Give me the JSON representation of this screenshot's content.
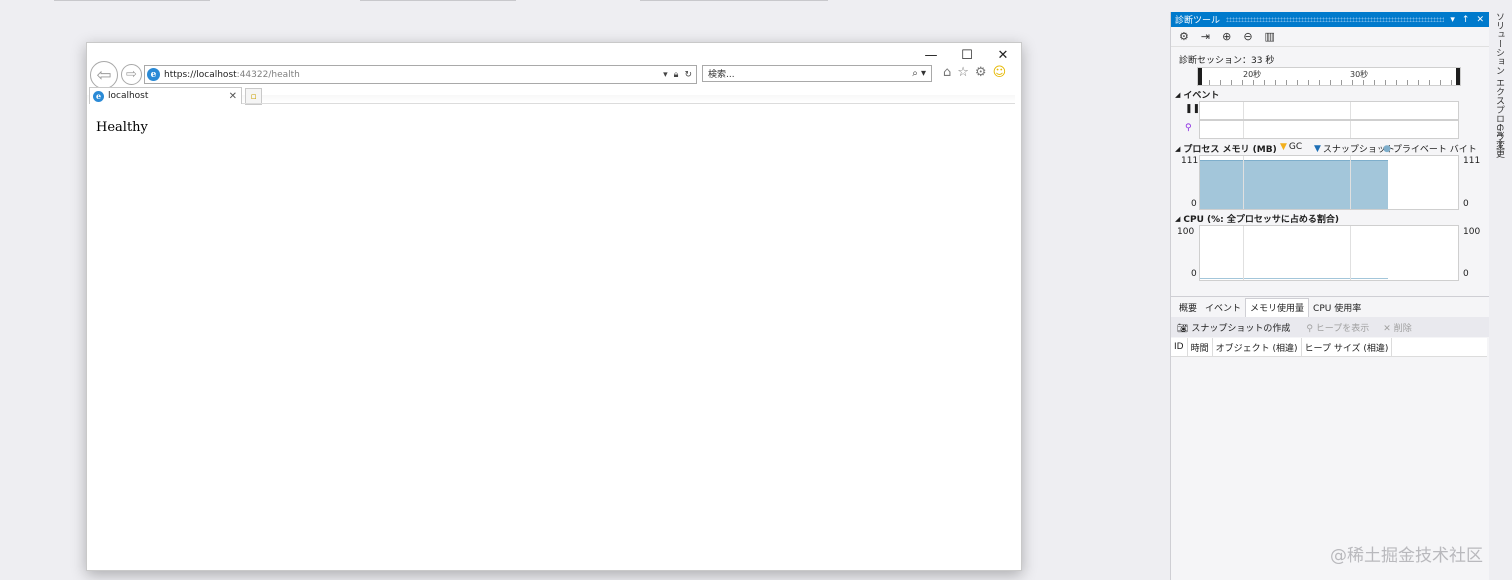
{
  "browser": {
    "window_controls": {
      "minimize": "—",
      "maximize": "☐",
      "close": "✕"
    },
    "back_icon": "⇦",
    "forward_icon": "⇨",
    "address_host": "https://localhost",
    "address_path": ":44322/health",
    "search_placeholder": "検索...",
    "tab_label": "localhost",
    "tab_close": "✕",
    "page_text": "Healthy"
  },
  "diag": {
    "title": "診断ツール",
    "title_buttons": [
      "▾",
      "↑",
      "✕"
    ],
    "session": "診断セッション：33 秒",
    "ruler_labels": [
      "20秒",
      "30秒"
    ],
    "events_section": "イベント",
    "memory_section": "プロセス メモリ (MB)",
    "legend_gc": "GC",
    "legend_snapshot": "スナップショット",
    "legend_private": "プライベート バイト",
    "mem_max": "111",
    "mem_min": "0",
    "cpu_section": "CPU (%: 全プロセッサに占める割合)",
    "cpu_max": "100",
    "cpu_min": "0",
    "tabs": [
      "概要",
      "イベント",
      "メモリ使用量",
      "CPU 使用率"
    ],
    "snapshot_button": "スナップショットの作成",
    "view_heap": "ヒープを表示",
    "delete": "削除",
    "columns": [
      "ID",
      "時間",
      "オブジェクト (相違)",
      "ヒープ サイズ (相違)"
    ]
  },
  "vertical_tabs": [
    "ソリューション エクスプローラー",
    "Git 変更"
  ],
  "watermark": "@稀土掘金技术社区",
  "colors": {
    "accent": "#007acc",
    "memory_fill": "#a3c6da",
    "gc_marker": "#f2b01e",
    "snapshot_marker": "#1e6fb5"
  }
}
